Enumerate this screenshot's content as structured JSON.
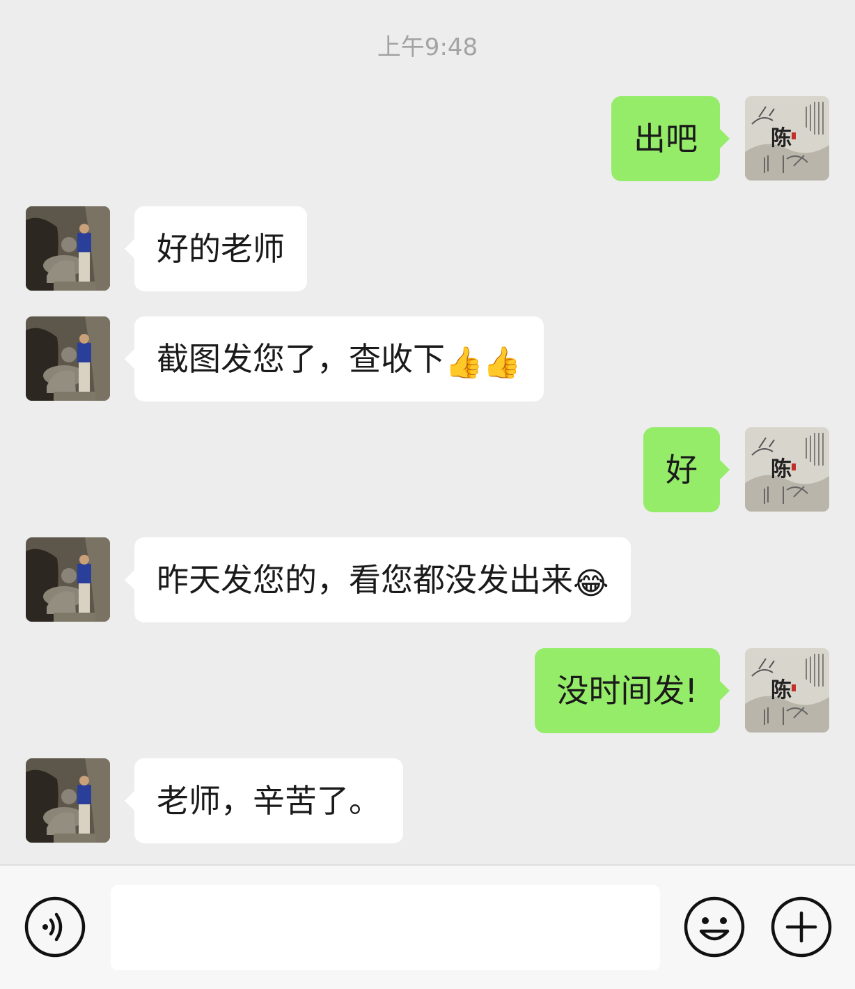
{
  "timestamp": "上午9:48",
  "messages": [
    {
      "side": "right",
      "text": "出吧",
      "emoji": ""
    },
    {
      "side": "left",
      "text": "好的老师",
      "emoji": ""
    },
    {
      "side": "left",
      "text": "截图发您了，查收下",
      "emoji": "👍👍"
    },
    {
      "side": "right",
      "text": "好",
      "emoji": ""
    },
    {
      "side": "left",
      "text": "昨天发您的，看您都没发出来",
      "emoji": "😂"
    },
    {
      "side": "right",
      "text": "没时间发!",
      "emoji": ""
    },
    {
      "side": "left",
      "text": "老师，辛苦了。",
      "emoji": ""
    }
  ],
  "self_avatar": {
    "char": "陈",
    "icon": "calligraphy-landscape-avatar"
  },
  "contact_avatar": {
    "icon": "man-with-tiger-statue-photo"
  },
  "input": {
    "value": "",
    "placeholder": ""
  },
  "toolbar": {
    "voice_icon": "voice-icon",
    "emoji_icon": "emoji-icon",
    "plus_icon": "plus-icon"
  },
  "colors": {
    "background": "#ededed",
    "self_bubble": "#95ec69",
    "other_bubble": "#ffffff"
  }
}
